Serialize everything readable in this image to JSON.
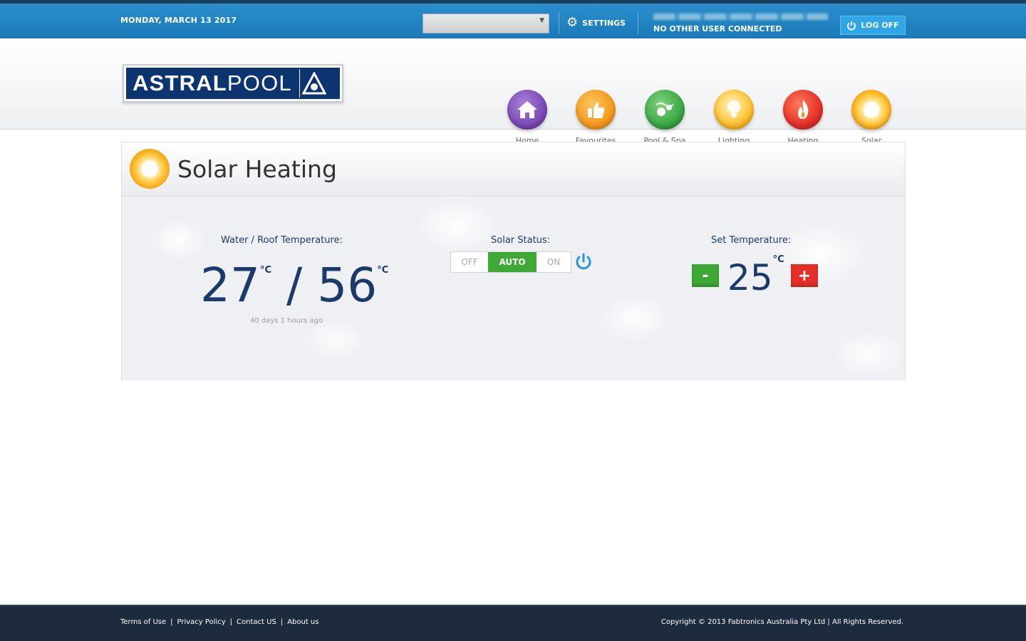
{
  "topbar": {
    "date": "MONDAY, MARCH 13 2017",
    "site_select_value": "",
    "settings_label": "SETTINGS",
    "user_status": "NO OTHER USER CONNECTED",
    "logoff_label": "LOG OFF"
  },
  "brand": {
    "logo_bold": "ASTRAL",
    "logo_light": "POOL"
  },
  "nav": [
    {
      "label": "Home",
      "icon": "home-icon",
      "color": "#7c4ab5"
    },
    {
      "label": "Favourites",
      "icon": "thumbs-up-icon",
      "color": "#f39a1e"
    },
    {
      "label": "Pool & Spa",
      "icon": "pool-spa-icon",
      "color": "#3aa845"
    },
    {
      "label": "Lighting",
      "icon": "lightbulb-icon",
      "color": "#f7b21a"
    },
    {
      "label": "Heating",
      "icon": "flame-icon",
      "color": "#e5302a"
    },
    {
      "label": "Solar",
      "icon": "sun-icon",
      "color": "#f6a81c"
    }
  ],
  "panel": {
    "title": "Solar Heating",
    "water_roof_label": "Water / Roof Temperature:",
    "water_temp": "27",
    "roof_temp": "56",
    "separator": "/",
    "unit": "°C",
    "last_updated": "40 days 1 hours ago",
    "solar_status_label": "Solar Status:",
    "switch_off": "OFF",
    "switch_auto": "AUTO",
    "switch_on": "ON",
    "set_temp_label": "Set Temperature:",
    "set_temp": "25",
    "minus_label": "-",
    "plus_label": "+"
  },
  "footer": {
    "links": [
      "Terms of Use",
      "Privacy Policy",
      "Contact US",
      "About us"
    ],
    "copyright": "Copyright © 2013 Fabtronics Australia Pty Ltd  |  All Rights Reserved."
  },
  "colors": {
    "accent": "#1b79b8",
    "auto_green": "#3ea935",
    "minus_green": "#3ea935",
    "plus_red": "#e5302a",
    "text_navy": "#1b3a6b"
  }
}
